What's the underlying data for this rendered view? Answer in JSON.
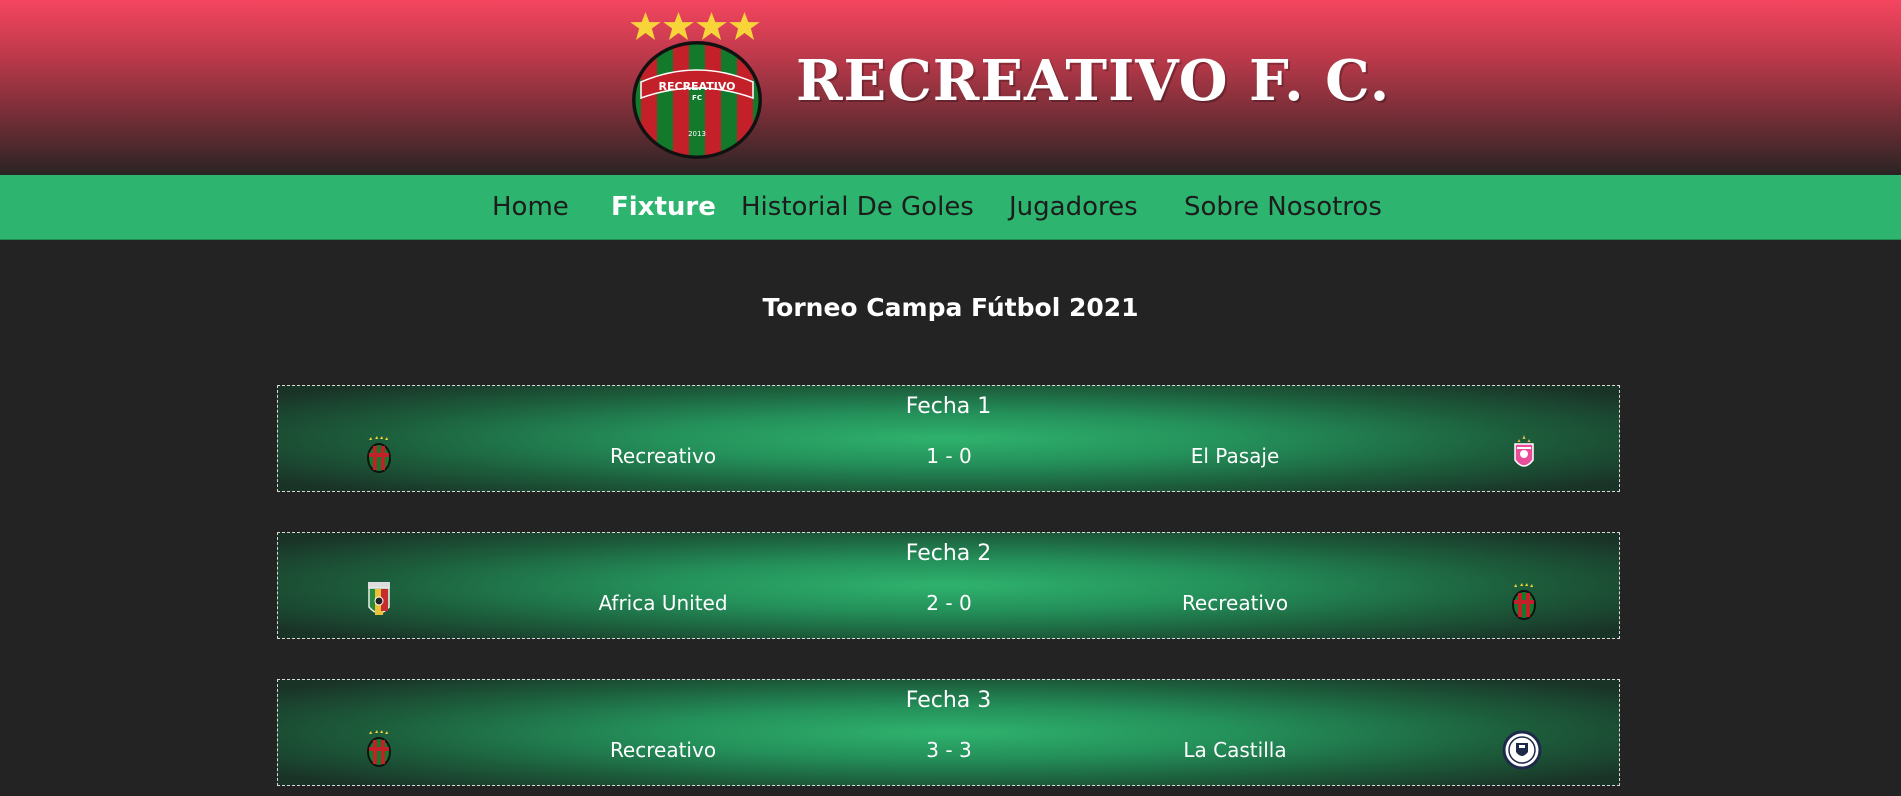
{
  "header": {
    "title": "RECREATIVO F. C.",
    "crest": {
      "top_text": "RECREATIVO",
      "sub_text": "FC",
      "year": "2013"
    }
  },
  "nav": {
    "items": [
      {
        "label": "Home",
        "active": false
      },
      {
        "label": "Fixture",
        "active": true
      },
      {
        "label": "Historial De Goles",
        "active": false
      },
      {
        "label": "Jugadores",
        "active": false
      },
      {
        "label": "Sobre Nosotros",
        "active": false
      }
    ]
  },
  "main": {
    "tournament_title": "Torneo Campa Fútbol 2021",
    "matches": [
      {
        "round": "Fecha 1",
        "home": "Recreativo",
        "score": "1 - 0",
        "away": "El Pasaje",
        "home_badge": "recreativo-badge-icon",
        "away_badge": "el-pasaje-badge-icon"
      },
      {
        "round": "Fecha 2",
        "home": "Africa United",
        "score": "2 - 0",
        "away": "Recreativo",
        "home_badge": "africa-united-badge-icon",
        "away_badge": "recreativo-badge-icon"
      },
      {
        "round": "Fecha 3",
        "home": "Recreativo",
        "score": "3 - 3",
        "away": "La Castilla",
        "home_badge": "recreativo-badge-icon",
        "away_badge": "la-castilla-badge-icon"
      }
    ]
  },
  "colors": {
    "header_top": "#f5455f",
    "header_bottom": "#2a2424",
    "nav_green": "#2db56f",
    "page_background": "#232323",
    "crest_red": "#c4202a",
    "crest_green": "#137a2c",
    "star_yellow": "#f7d43a"
  }
}
